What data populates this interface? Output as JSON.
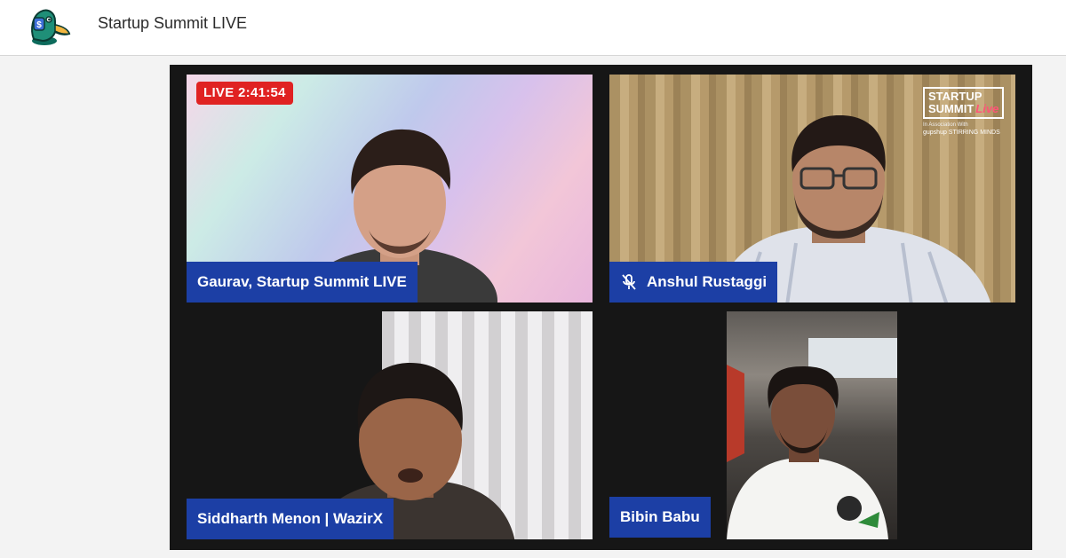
{
  "header": {
    "title": "Startup Summit LIVE"
  },
  "stage": {
    "live_badge": "LIVE 2:41:54",
    "brand": {
      "line1": "STARTUP",
      "line2": "SUMMIT",
      "live": "Live",
      "association": "In Association With",
      "partners": "gupshup STIRRING MINDS"
    },
    "participants": [
      {
        "name": "Gaurav, Startup Summit LIVE",
        "muted": false
      },
      {
        "name": "Anshul Rustaggi",
        "muted": true
      },
      {
        "name": "Siddharth Menon | WazirX",
        "muted": false
      },
      {
        "name": "Bibin Babu",
        "muted": false
      }
    ]
  },
  "colors": {
    "nametag": "#1c3fa5",
    "live_badge": "#e02222",
    "stage_bg": "#161616"
  }
}
